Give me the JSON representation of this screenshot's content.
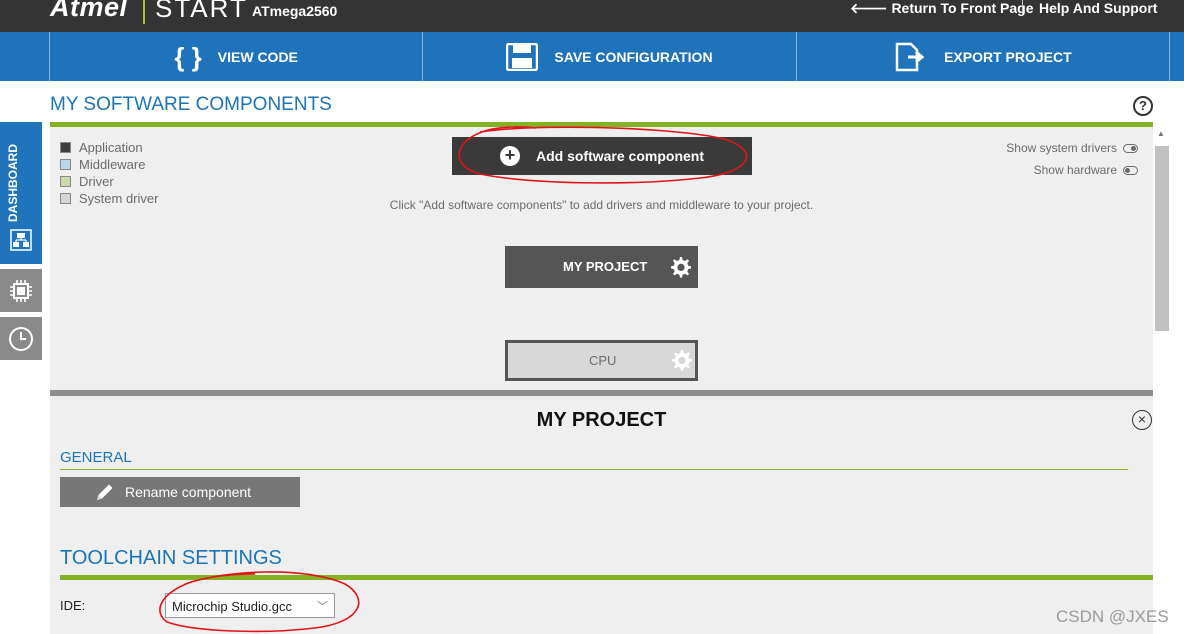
{
  "header": {
    "brand": "Atmel",
    "product": "START",
    "device": "ATmega2560",
    "return_link": "Return To Front Page",
    "help_link": "Help And Support"
  },
  "toolbar": {
    "view_code_icon": "{ }",
    "view_code": "VIEW CODE",
    "save_configuration": "SAVE CONFIGURATION",
    "export_project": "EXPORT PROJECT"
  },
  "sidebar": {
    "dashboard_label": "DASHBOARD"
  },
  "components": {
    "title": "MY SOFTWARE COMPONENTS",
    "legend": [
      {
        "label": "Application",
        "color": "#3f3f3f"
      },
      {
        "label": "Middleware",
        "color": "#b9d6ea"
      },
      {
        "label": "Driver",
        "color": "#c9d9a8"
      },
      {
        "label": "System driver",
        "color": "#d5d5d5"
      }
    ],
    "add_button": "Add software component",
    "hint": "Click \"Add software components\" to add drivers and middleware to your project.",
    "show_system_drivers": "Show system drivers",
    "show_hardware": "Show hardware",
    "project_node": "MY PROJECT",
    "cpu_node": "CPU"
  },
  "details": {
    "title": "MY PROJECT",
    "general_heading": "GENERAL",
    "rename_button": "Rename component",
    "toolchain_heading": "TOOLCHAIN SETTINGS",
    "ide_label": "IDE:",
    "ide_value": "Microchip Studio.gcc"
  },
  "watermark": "CSDN @JXES",
  "colors": {
    "accent_blue": "#1f73bb",
    "accent_green": "#83b226",
    "header_dark": "#343434",
    "annotation_red": "#e0141b"
  }
}
